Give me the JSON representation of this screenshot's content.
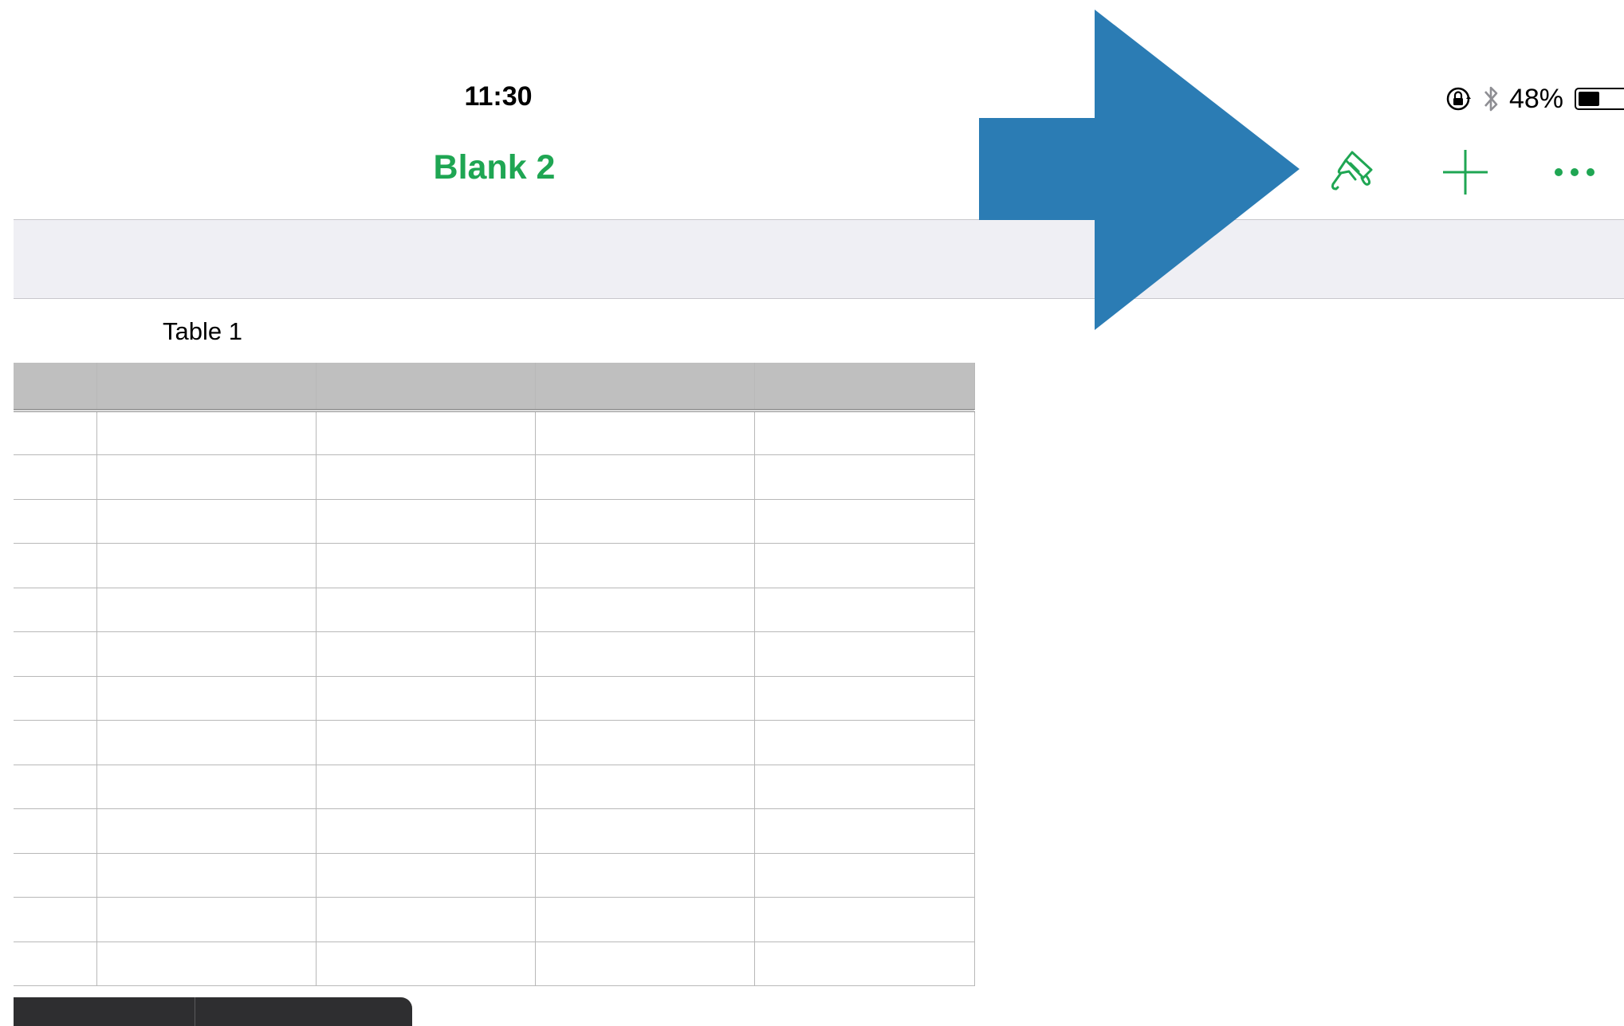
{
  "status_bar": {
    "time": "11:30",
    "battery_text": "48%",
    "battery_level": 0.48,
    "icons": [
      "rotation-lock-icon",
      "bluetooth-icon",
      "battery-icon"
    ]
  },
  "nav_bar": {
    "title": "Blank 2",
    "buttons": [
      "paintbrush-icon",
      "add-icon",
      "more-icon"
    ]
  },
  "table": {
    "title": "Table 1",
    "header_rows": 1,
    "body_rows": 13,
    "columns": 5
  },
  "overlay": {
    "arrow_icon": "arrow-right-icon",
    "arrow_color": "#2b7cb4"
  },
  "colors": {
    "accent": "#1fa653",
    "header_fill": "#bfbfbf",
    "toolbar_fill": "#efeff4"
  }
}
